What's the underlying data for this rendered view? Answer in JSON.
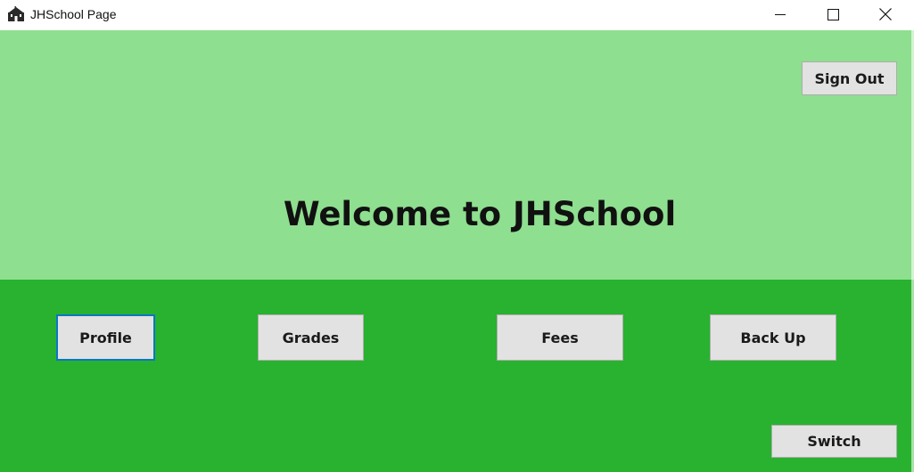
{
  "window": {
    "title": "JHSchool Page",
    "icon": "school-building-icon",
    "controls": [
      "minimize-icon",
      "maximize-icon",
      "close-icon"
    ]
  },
  "header": {
    "welcome_text": "Welcome to JHSchool",
    "sign_out_label": "Sign Out"
  },
  "nav": {
    "profile_label": "Profile",
    "grades_label": "Grades",
    "fees_label": "Fees",
    "backup_label": "Back Up"
  },
  "footer": {
    "switch_label": "Switch"
  },
  "colors": {
    "top_panel": "#8edf8f",
    "bottom_panel": "#28b22f",
    "button_face": "#e2e2e2",
    "focus_border": "#0a76c7"
  }
}
